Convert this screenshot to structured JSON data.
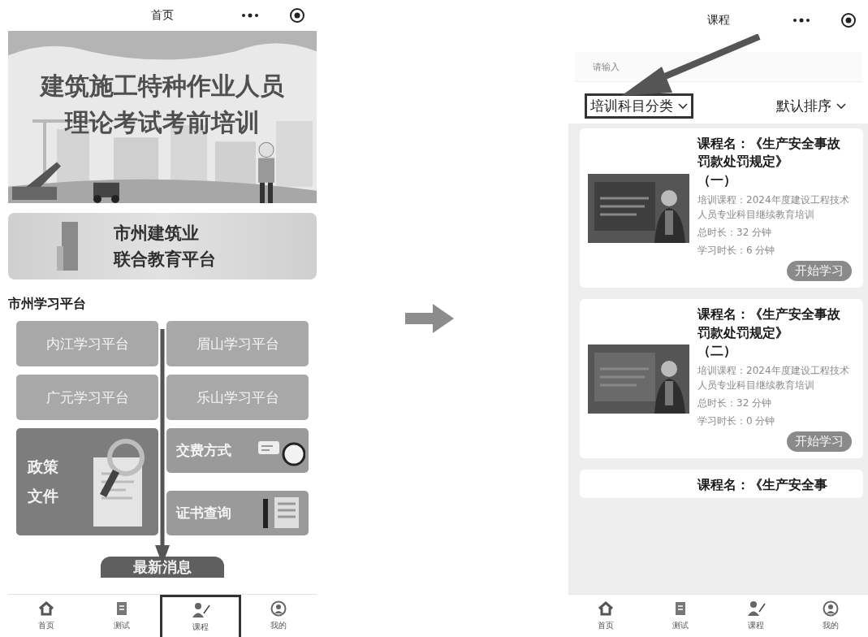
{
  "home_screen": {
    "title": "首页",
    "banner": {
      "line_1": "建筑施工特种作业人员",
      "line_2": "理论考试考前培训"
    },
    "platform_card": {
      "line_1": "市州建筑业",
      "line_2": "联合教育平台"
    },
    "section_title": "市州学习平台",
    "platforms": [
      "内江学习平台",
      "眉山学习平台",
      "广元学习平台",
      "乐山学习平台"
    ],
    "policy_tile": {
      "line_1": "政策",
      "line_2": "文件"
    },
    "side_tiles": [
      {
        "label": "交费方式",
        "kind": "payment"
      },
      {
        "label": "证书查询",
        "kind": "certificate"
      }
    ],
    "news_banner": "最新消息",
    "tabs": [
      {
        "label": "首页",
        "kind": "home",
        "highlighted": false
      },
      {
        "label": "测试",
        "kind": "test",
        "highlighted": false
      },
      {
        "label": "课程",
        "kind": "course",
        "highlighted": true
      },
      {
        "label": "我的",
        "kind": "me",
        "highlighted": false
      }
    ]
  },
  "course_screen": {
    "title": "课程",
    "search": {
      "placeholder": "请输入"
    },
    "filters": [
      {
        "label": "培训科目分类",
        "highlighted": true
      },
      {
        "label": "默认排序",
        "highlighted": false
      }
    ],
    "courses": [
      {
        "title": "课程名：《生产安全事故罚款处罚规定》",
        "part": "（一）",
        "training": "培训课程：2024年度建设工程技术人员专业科目继续教育培训",
        "total": "总时长：32 分钟",
        "studied": "学习时长：6 分钟",
        "button": "开始学习"
      },
      {
        "title": "课程名：《生产安全事故罚款处罚规定》",
        "part": "（二）",
        "training": "培训课程：2024年度建设工程技术人员专业科目继续教育培训",
        "total": "总时长：32 分钟",
        "studied": "学习时长：0 分钟",
        "button": "开始学习"
      }
    ],
    "cut_course_title": "课程名：《生产安全事",
    "tabs": [
      {
        "label": "首页",
        "kind": "home"
      },
      {
        "label": "测试",
        "kind": "test"
      },
      {
        "label": "课程",
        "kind": "course"
      },
      {
        "label": "我的",
        "kind": "me"
      }
    ]
  }
}
